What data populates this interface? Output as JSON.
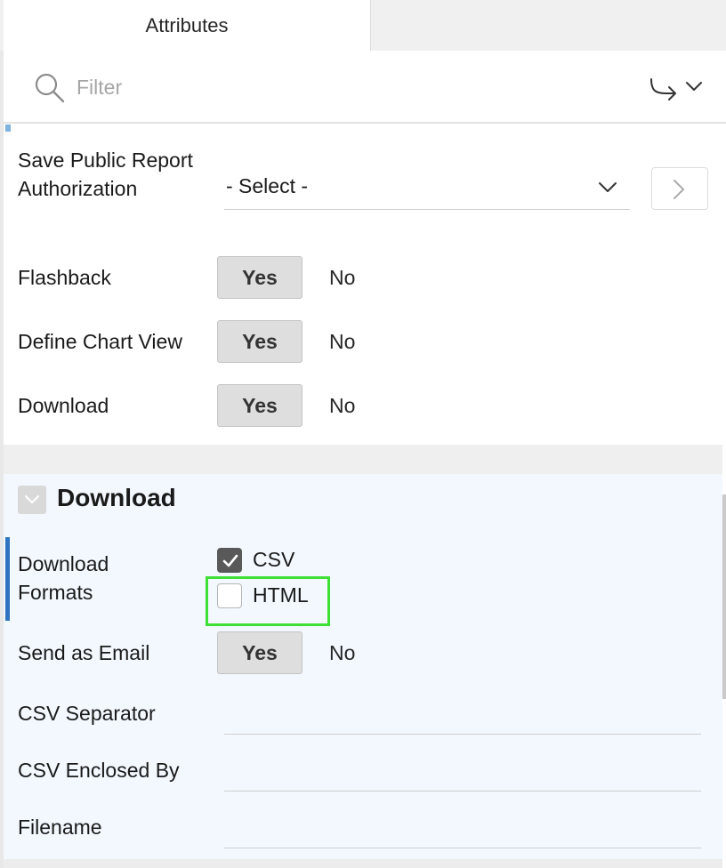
{
  "tabs": {
    "active_label": "Attributes"
  },
  "filter": {
    "placeholder": "Filter"
  },
  "report_settings": {
    "save_public_report_authorization": {
      "label": "Save Public Report Authorization",
      "select_value": "- Select -"
    },
    "flashback": {
      "label": "Flashback",
      "yes": "Yes",
      "no": "No",
      "selected": "Yes"
    },
    "define_chart_view": {
      "label": "Define Chart View",
      "yes": "Yes",
      "no": "No",
      "selected": "Yes"
    },
    "download": {
      "label": "Download",
      "yes": "Yes",
      "no": "No",
      "selected": "Yes"
    }
  },
  "download_section": {
    "title": "Download",
    "formats": {
      "label": "Download Formats",
      "options": [
        {
          "label": "CSV",
          "checked": true
        },
        {
          "label": "HTML",
          "checked": false
        }
      ]
    },
    "send_as_email": {
      "label": "Send as Email",
      "yes": "Yes",
      "no": "No",
      "selected": "Yes"
    },
    "csv_separator": {
      "label": "CSV Separator",
      "value": ""
    },
    "csv_enclosed_by": {
      "label": "CSV Enclosed By",
      "value": ""
    },
    "filename": {
      "label": "Filename",
      "value": ""
    }
  },
  "colors": {
    "highlight": "#3ee036",
    "active_bar": "#2f74c0",
    "panel_bg": "#f2f8fe"
  },
  "icons": {
    "filter": "search-icon",
    "go": "go-to-icon",
    "collapse": "chevron-down-icon",
    "checkbox": "check-icon"
  }
}
